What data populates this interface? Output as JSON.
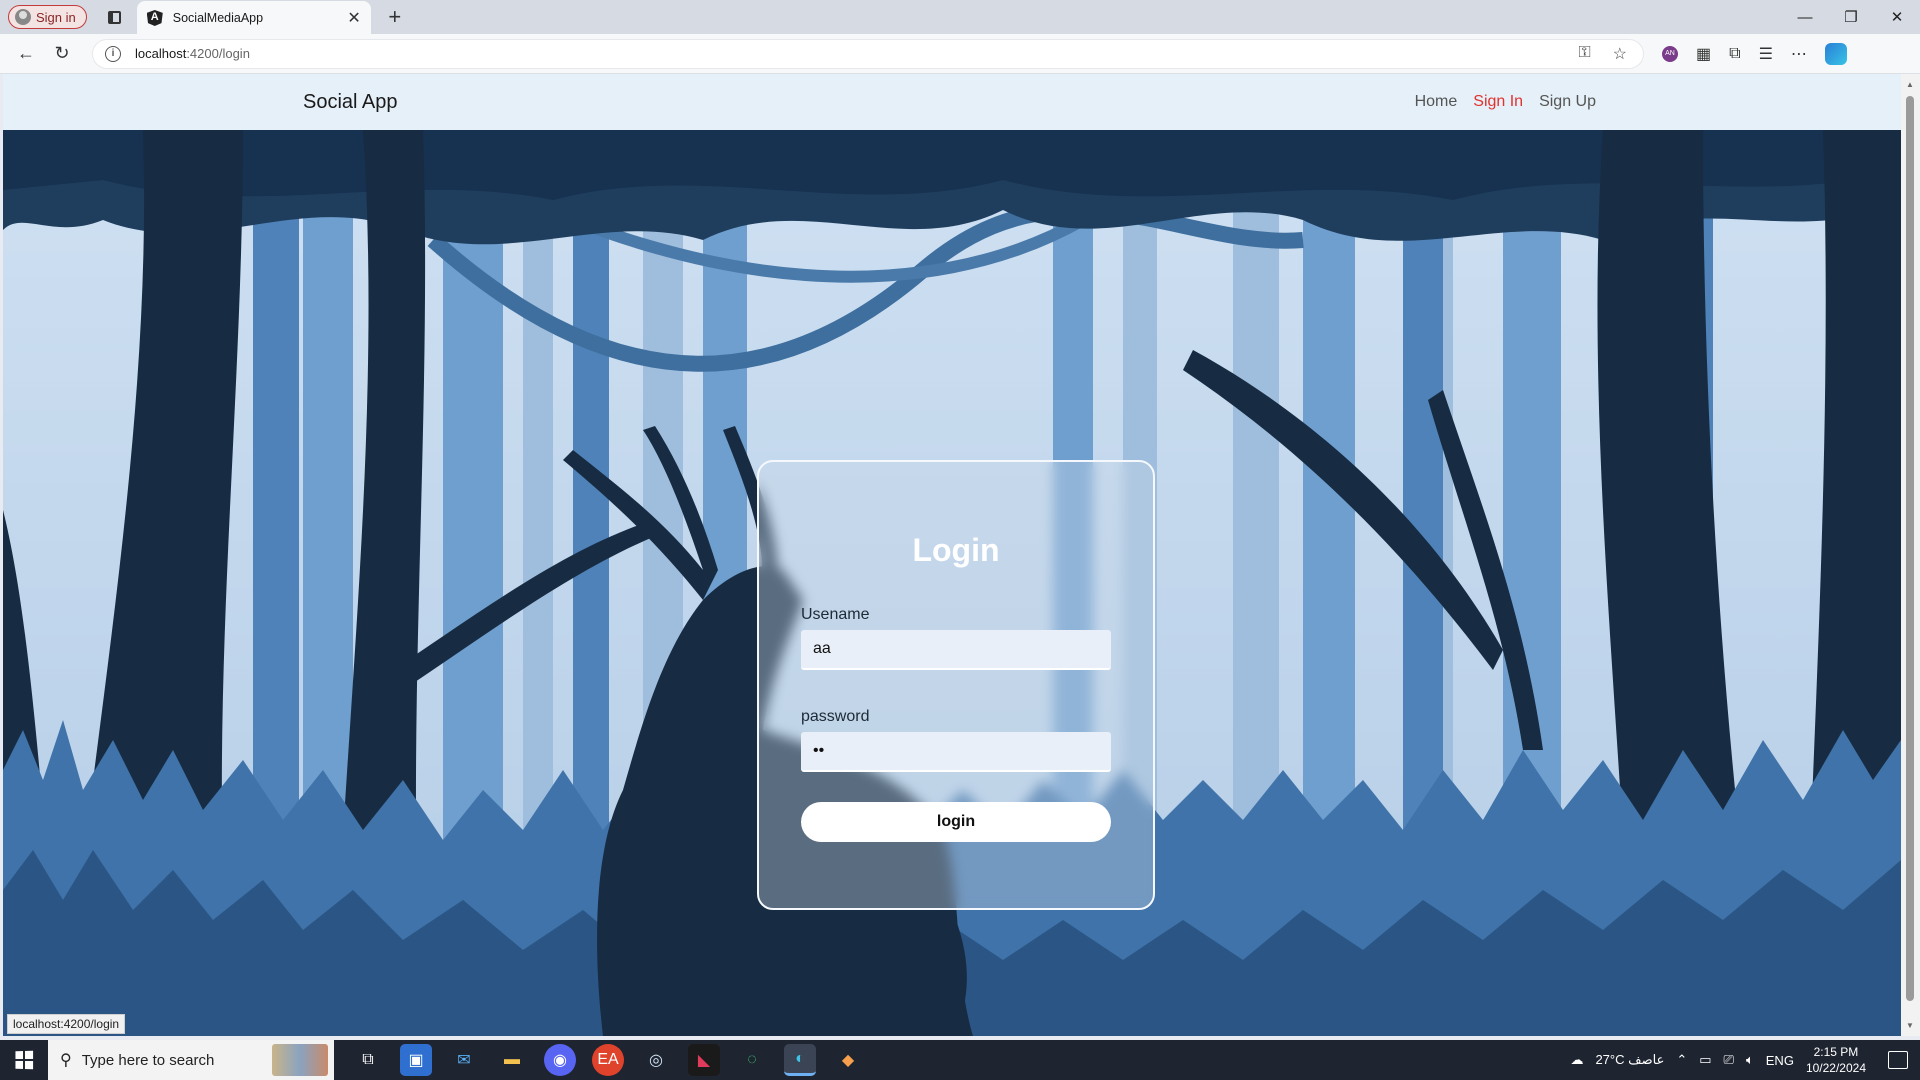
{
  "browser": {
    "profile_label": "Sign in",
    "tab_title": "SocialMediaApp",
    "url_host": "localhost",
    "url_rest": ":4200/login",
    "status_url": "localhost:4200/login"
  },
  "app": {
    "brand": "Social App",
    "nav": [
      {
        "label": "Home"
      },
      {
        "label": "Sign In"
      },
      {
        "label": "Sign Up"
      }
    ],
    "active_color": "#e0322e"
  },
  "login": {
    "title": "Login",
    "username_label": "Usename",
    "username_value": "aa",
    "password_label": "password",
    "password_value": "aa",
    "button_label": "login"
  },
  "taskbar": {
    "search_placeholder": "Type here to search",
    "weather": "27°C  عاصف",
    "language": "ENG",
    "time": "2:15 PM",
    "date": "10/22/2024"
  }
}
